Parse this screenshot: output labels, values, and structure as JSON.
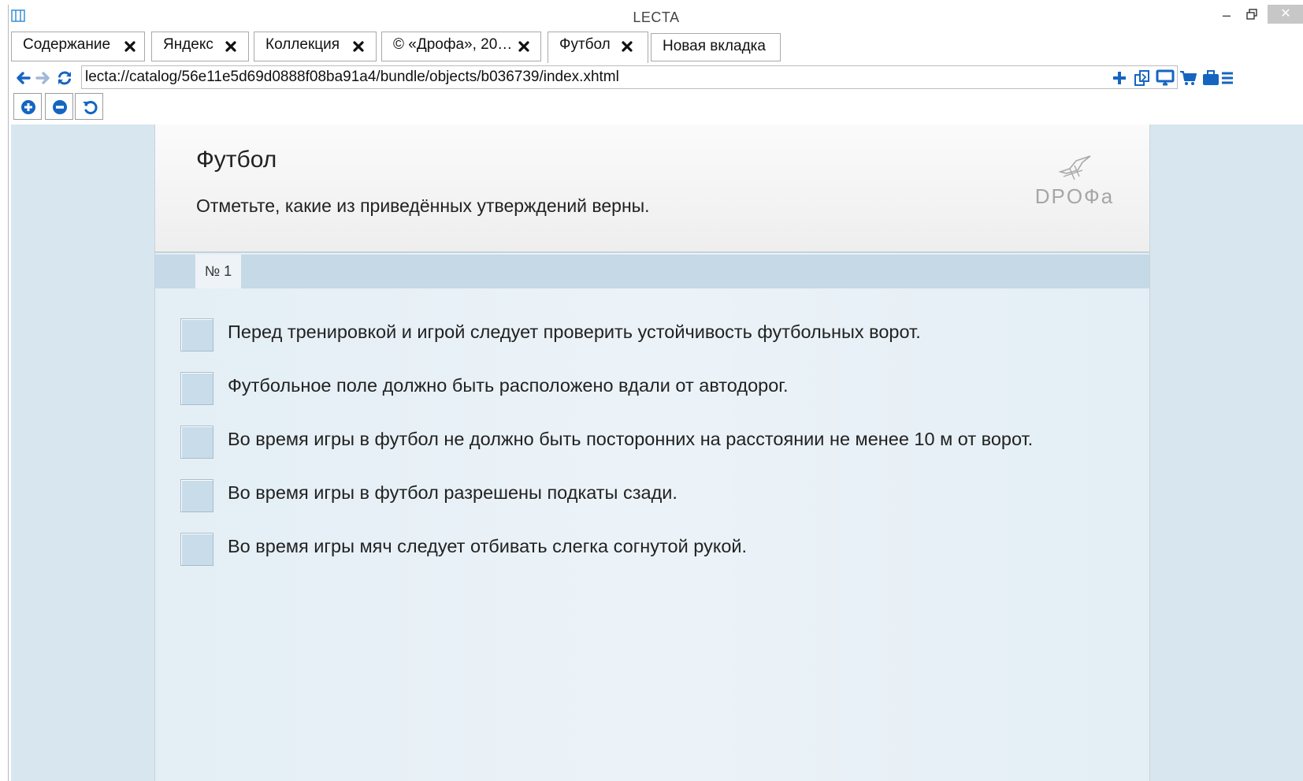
{
  "window": {
    "title": "LECTA",
    "min_label": "–",
    "close_label": "✕"
  },
  "tabs": [
    {
      "label": "Содержание",
      "closable": true
    },
    {
      "label": "Яндекс",
      "closable": true
    },
    {
      "label": "Коллекция",
      "closable": true
    },
    {
      "label": "© «Дрофа», 20…",
      "closable": true
    },
    {
      "label": "Футбол",
      "closable": true,
      "active": true
    },
    {
      "label": "Новая вкладка",
      "closable": false
    }
  ],
  "address_bar": {
    "url": "lecta://catalog/56e11e5d69d0888f08ba91a4/bundle/objects/b036739/index.xhtml"
  },
  "icons": {
    "back": "arrow-left-icon",
    "forward": "arrow-right-icon",
    "reload": "refresh-icon",
    "add": "plus-icon",
    "bookmarks": "bookmarks-icon",
    "screen": "monitor-icon",
    "cart": "cart-icon",
    "briefcase": "briefcase-icon",
    "menu": "menu-icon",
    "zoom_in": "zoom-in-icon",
    "zoom_out": "zoom-out-icon",
    "zoom_reset": "reset-icon"
  },
  "colors": {
    "accent": "#1565c0",
    "checkbox": "#c8dce9",
    "page_bg": "#d7e6ef"
  },
  "task": {
    "title": "Футбол",
    "instruction": "Отметьте, какие из приведённых утверждений верны.",
    "publisher": "DPOФa",
    "number_label": "№ 1",
    "options": [
      {
        "text": "Перед тренировкой и игрой следует проверить устойчивость футбольных ворот.",
        "checked": false
      },
      {
        "text": "Футбольное поле должно быть расположено вдали от автодорог.",
        "checked": false
      },
      {
        "text": "Во время игры в футбол не должно быть посторонних на расстоянии не менее 10 м от ворот.",
        "checked": false
      },
      {
        "text": "Во время игры в футбол разрешены подкаты сзади.",
        "checked": false
      },
      {
        "text": "Во время игры мяч следует отбивать слегка согнутой рукой.",
        "checked": false
      }
    ]
  }
}
